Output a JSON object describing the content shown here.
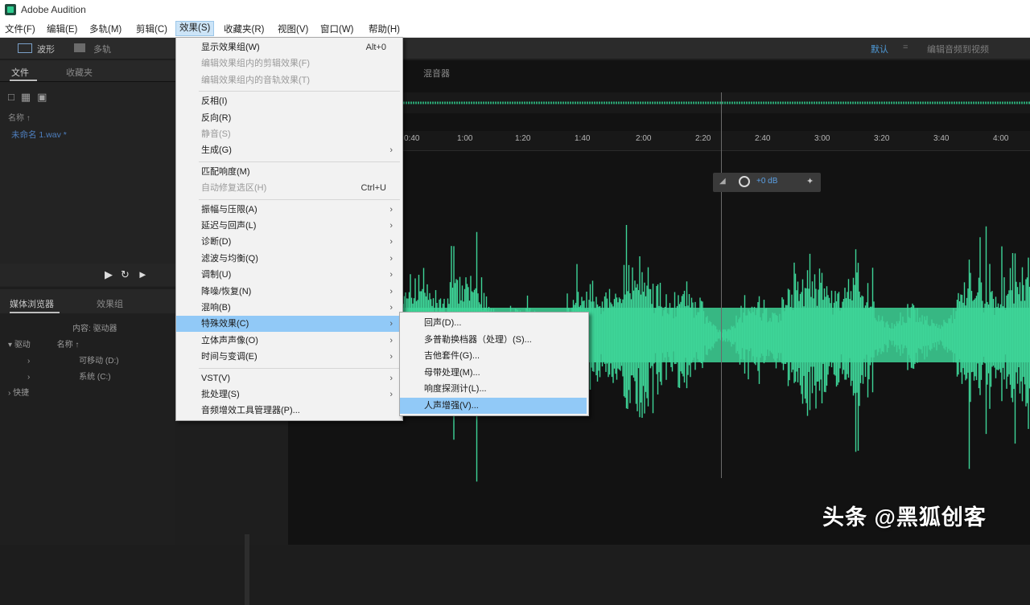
{
  "window": {
    "title": "Adobe Audition"
  },
  "menubar": {
    "items": [
      "文件(F)",
      "编辑(E)",
      "多轨(M)",
      "剪辑(C)",
      "效果(S)",
      "收藏夹(R)",
      "视图(V)",
      "窗口(W)",
      "帮助(H)"
    ]
  },
  "toolbar": {
    "waveform": "波形",
    "multitrack": "多轨",
    "workspace": "默认",
    "separator": "=",
    "edit_audio": "编辑音频到视频"
  },
  "files_panel": {
    "tab_files": "文件",
    "tab_favorites": "收藏夹",
    "column_name": "名称 ↑",
    "file_name": "未命名 1.wav *"
  },
  "media_browser": {
    "tab_browser": "媒体浏览器",
    "tab_effects_group": "效果组",
    "content_label": "内容:",
    "content_value": "驱动器",
    "tree_drives": "驱动",
    "tree_name_col": "名称 ↑",
    "drive_removable": "可移动 (D:)",
    "drive_c": "系统 (C:)",
    "tree_shortcuts": "快捷"
  },
  "editor": {
    "tab_label": "混音器",
    "timeline_ticks": [
      "0:40",
      "1:00",
      "1:20",
      "1:40",
      "2:00",
      "2:20",
      "2:40",
      "3:00",
      "3:20",
      "3:40",
      "4:00"
    ],
    "hud_value": "+0 dB",
    "waveform_color": "#3ed598"
  },
  "effects_menu": {
    "items": [
      {
        "label": "显示效果组(W)",
        "shortcut": "Alt+0",
        "disabled": false,
        "submenu": false
      },
      {
        "label": "编辑效果组内的剪辑效果(F)",
        "disabled": true,
        "submenu": false
      },
      {
        "label": "编辑效果组内的音轨效果(T)",
        "disabled": true,
        "submenu": false
      },
      {
        "sep": true
      },
      {
        "label": "反相(I)",
        "disabled": false,
        "submenu": false
      },
      {
        "label": "反向(R)",
        "disabled": false,
        "submenu": false
      },
      {
        "label": "静音(S)",
        "disabled": true,
        "submenu": false
      },
      {
        "label": "生成(G)",
        "disabled": false,
        "submenu": true
      },
      {
        "sep": true
      },
      {
        "label": "匹配响度(M)",
        "disabled": false,
        "submenu": false
      },
      {
        "label": "自动修复选区(H)",
        "shortcut": "Ctrl+U",
        "disabled": true,
        "submenu": false
      },
      {
        "sep": true
      },
      {
        "label": "振幅与压限(A)",
        "disabled": false,
        "submenu": true
      },
      {
        "label": "延迟与回声(L)",
        "disabled": false,
        "submenu": true
      },
      {
        "label": "诊断(D)",
        "disabled": false,
        "submenu": true
      },
      {
        "label": "滤波与均衡(Q)",
        "disabled": false,
        "submenu": true
      },
      {
        "label": "调制(U)",
        "disabled": false,
        "submenu": true
      },
      {
        "label": "降噪/恢复(N)",
        "disabled": false,
        "submenu": true
      },
      {
        "label": "混响(B)",
        "disabled": false,
        "submenu": true
      },
      {
        "label": "特殊效果(C)",
        "disabled": false,
        "submenu": true,
        "highlight": true
      },
      {
        "label": "立体声声像(O)",
        "disabled": false,
        "submenu": true
      },
      {
        "label": "时间与变调(E)",
        "disabled": false,
        "submenu": true
      },
      {
        "sep": true
      },
      {
        "label": "VST(V)",
        "disabled": false,
        "submenu": true
      },
      {
        "label": "批处理(S)",
        "disabled": false,
        "submenu": true
      },
      {
        "label": "音频增效工具管理器(P)...",
        "disabled": false,
        "submenu": false
      }
    ]
  },
  "special_submenu": {
    "items": [
      {
        "label": "回声(D)..."
      },
      {
        "label": "多普勒换档器（处理）(S)..."
      },
      {
        "label": "吉他套件(G)..."
      },
      {
        "label": "母带处理(M)..."
      },
      {
        "label": "响度探测计(L)..."
      },
      {
        "label": "人声增强(V)...",
        "highlight": true
      }
    ]
  },
  "watermark": "头条 @黑狐创客"
}
